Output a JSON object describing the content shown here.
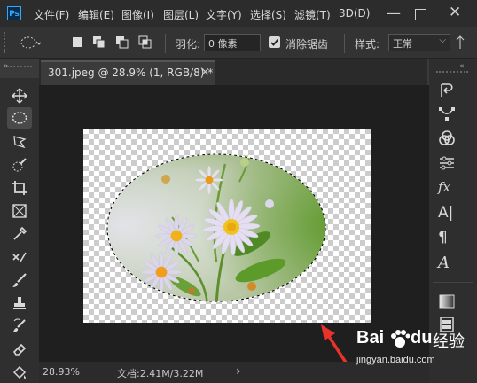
{
  "menubar": {
    "logo": "Ps",
    "items": [
      "文件(F)",
      "编辑(E)",
      "图像(I)",
      "图层(L)",
      "文字(Y)",
      "选择(S)",
      "滤镜(T)",
      "3D(D)"
    ]
  },
  "options": {
    "feather_label": "羽化:",
    "feather_value": "0 像素",
    "antialias_label": "消除锯齿",
    "style_label": "样式:",
    "style_value": "正常"
  },
  "tab": {
    "title": "301.jpeg @ 28.9% (1, RGB/8) *",
    "close": "×"
  },
  "status": {
    "zoom": "28.93%",
    "doc_info": "文档:2.41M/3.22M",
    "arrow": "›"
  },
  "watermark": {
    "brand": "Bai",
    "paw": "du",
    "suffix": "经验",
    "url": "jingyan.baidu.com"
  },
  "colors": {
    "accent": "#31a8ff",
    "arrow_red": "#e8322a"
  }
}
